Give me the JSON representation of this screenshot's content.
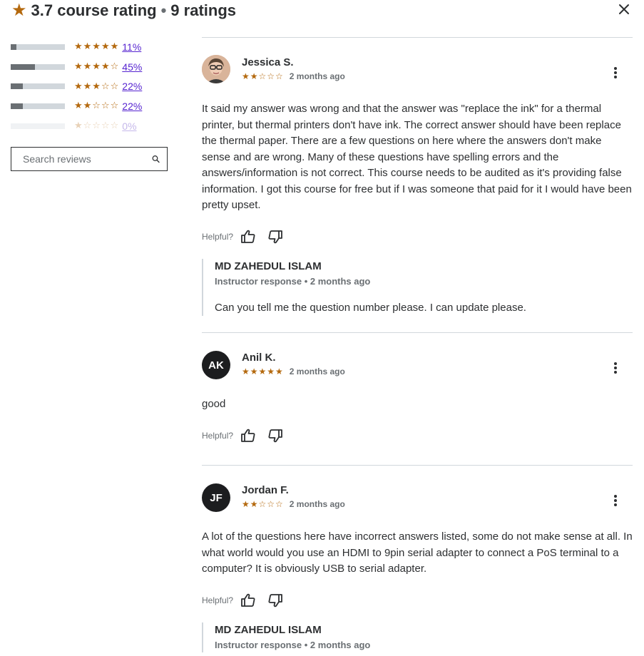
{
  "header": {
    "rating": "3.7 course rating",
    "separator": "•",
    "count": "9 ratings"
  },
  "distribution": [
    {
      "stars": "★★★★★",
      "percent": "11%",
      "fill": 0.11
    },
    {
      "stars": "★★★★☆",
      "percent": "45%",
      "fill": 0.45
    },
    {
      "stars": "★★★☆☆",
      "percent": "22%",
      "fill": 0.22
    },
    {
      "stars": "★★☆☆☆",
      "percent": "22%",
      "fill": 0.22
    },
    {
      "stars": "★☆☆☆☆",
      "percent": "0%",
      "fill": 0
    }
  ],
  "search": {
    "placeholder": "Search reviews"
  },
  "helpful_label": "Helpful?",
  "reviews": [
    {
      "avatar_initials": "",
      "name": "Jessica S.",
      "stars": "★★☆☆☆",
      "date": "2 months ago",
      "text": "It said my answer was wrong and that the answer was \"replace the ink\" for a thermal printer, but thermal printers don't have ink. The correct answer should have been replace the thermal paper. There are a few questions on here where the answers don't make sense and are wrong. Many of these questions have spelling errors and the answers/information is not correct. This course needs to be audited as it's providing false information. I got this course for free but if I was someone that paid for it I would have been pretty upset.",
      "response": {
        "name": "MD ZAHEDUL ISLAM",
        "meta": "Instructor response • 2 months ago",
        "text": "Can you tell me the question number please. I can update please."
      }
    },
    {
      "avatar_initials": "AK",
      "name": "Anil K.",
      "stars": "★★★★★",
      "date": "2 months ago",
      "text": "good"
    },
    {
      "avatar_initials": "JF",
      "name": "Jordan F.",
      "stars": "★★☆☆☆",
      "date": "2 months ago",
      "text": "A lot of the questions here have incorrect answers listed, some do not make sense at all. In what world would you use an HDMI to 9pin serial adapter to connect a PoS terminal to a computer? It is obviously USB to serial adapter.",
      "response": {
        "name": "MD ZAHEDUL ISLAM",
        "meta": "Instructor response • 2 months ago"
      }
    }
  ],
  "colors": {
    "star": "#b4690e",
    "link": "#5624d0",
    "bar_fill": "#6a6f73",
    "bar_track": "#d1d7dc"
  }
}
